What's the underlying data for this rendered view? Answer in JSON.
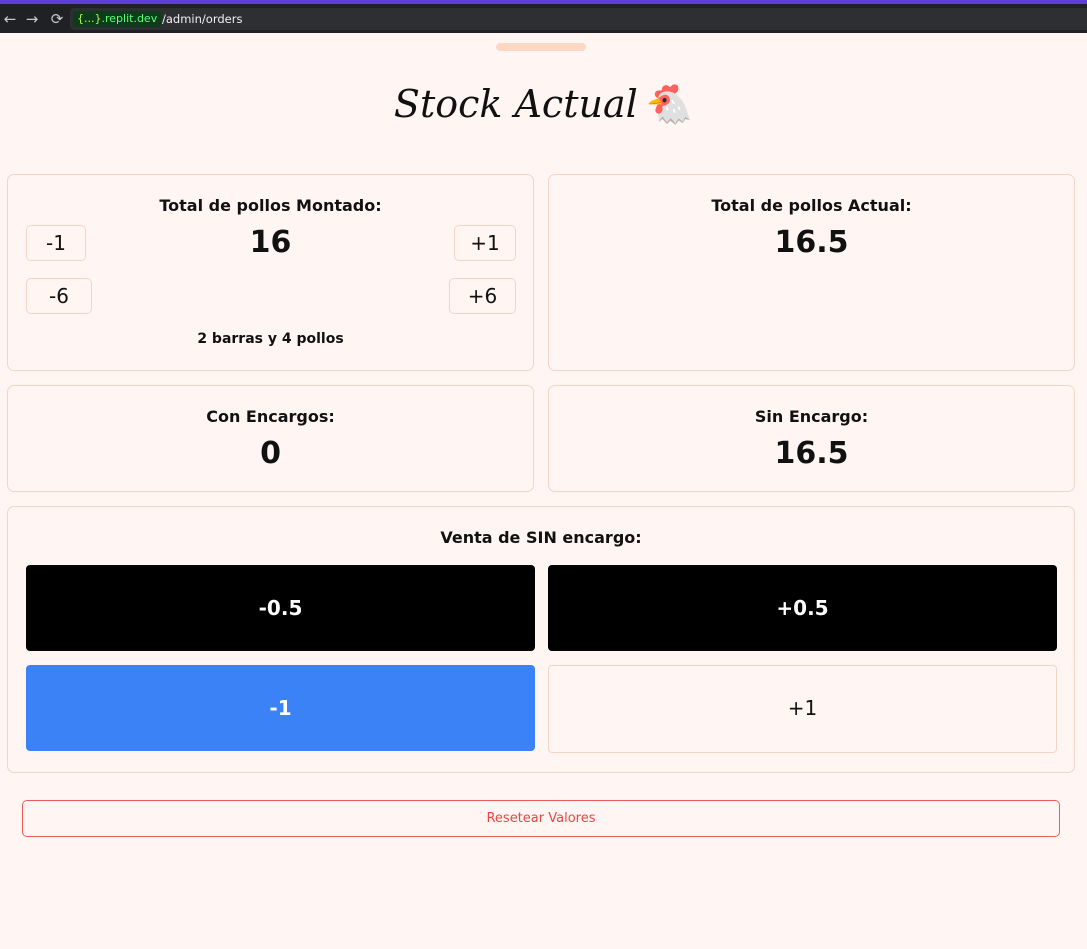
{
  "browser": {
    "back_icon": "←",
    "forward_icon": "→",
    "reload_icon": "⟳",
    "host_braces": "{...}",
    "host_domain": ".replit.dev",
    "path": "/admin/orders"
  },
  "header": {
    "title": "Stock Actual",
    "emoji": "🐔"
  },
  "montado": {
    "label": "Total de pollos Montado:",
    "value": "16",
    "minus_one": "-1",
    "plus_one": "+1",
    "minus_six": "-6",
    "plus_six": "+6",
    "summary": "2 barras y 4 pollos"
  },
  "actual": {
    "label": "Total de pollos Actual:",
    "value": "16.5"
  },
  "con_encargos": {
    "label": "Con Encargos:",
    "value": "0"
  },
  "sin_encargo": {
    "label": "Sin Encargo:",
    "value": "16.5"
  },
  "venta": {
    "label": "Venta de SIN encargo:",
    "minus_half": "-0.5",
    "plus_half": "+0.5",
    "minus_one": "-1",
    "plus_one": "+1"
  },
  "reset": {
    "label": "Resetear Valores"
  },
  "colors": {
    "background": "#fff6f3",
    "border": "#f3d5c7",
    "accent_blue": "#3b82f6",
    "danger": "#ef4444",
    "browser_accent": "#5b3fd6"
  }
}
